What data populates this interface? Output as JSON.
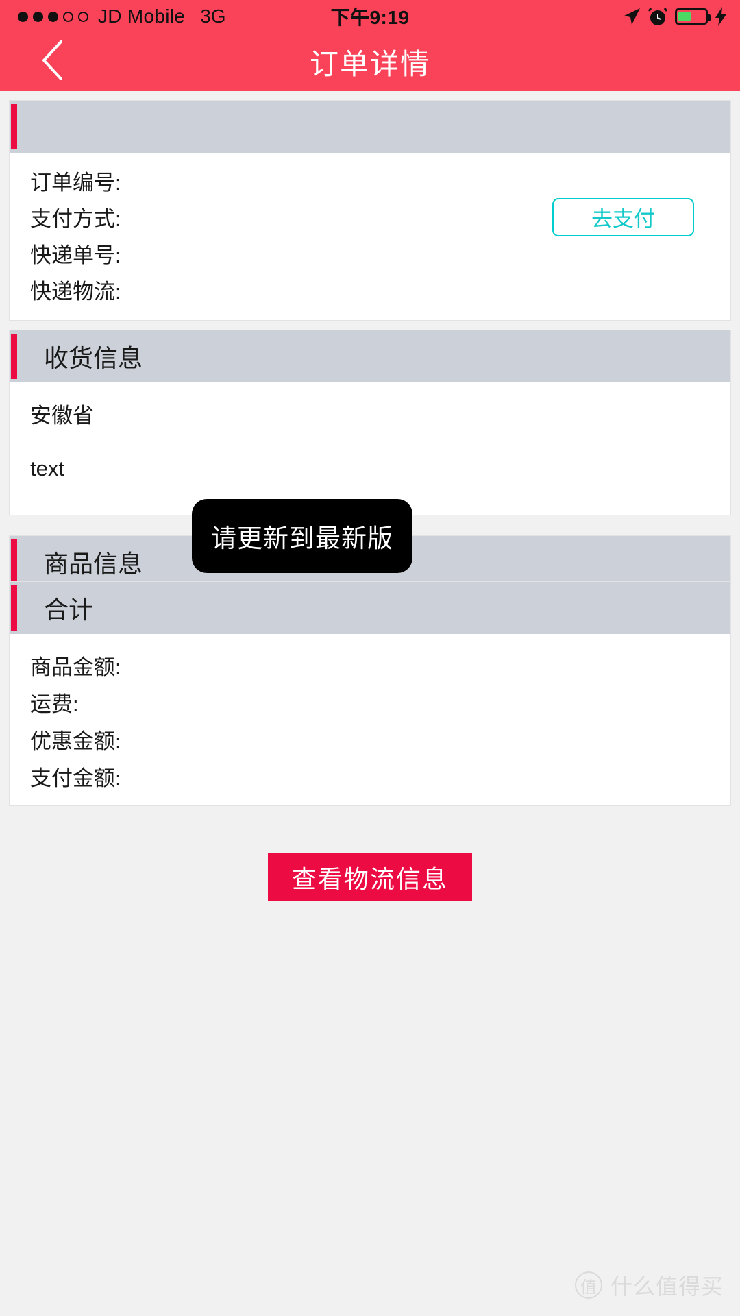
{
  "status_bar": {
    "signal_dots_filled": 3,
    "signal_dots_total": 5,
    "carrier": "JD Mobile",
    "network": "3G",
    "time": "下午9:19",
    "icons": [
      "location-arrow-icon",
      "alarm-clock-icon",
      "battery-icon",
      "charging-bolt-icon"
    ],
    "battery_level_percent": 42
  },
  "nav": {
    "back_icon": "chevron-left-icon",
    "title": "订单详情"
  },
  "colors": {
    "brand_red": "#fa4258",
    "accent_red": "#ec0b43",
    "header_gray": "#ccd0d8",
    "teal": "#00cdcd",
    "page_bg": "#f1f1f1"
  },
  "order_card": {
    "header_title": "",
    "rows": [
      {
        "label": "订单编号:",
        "value": ""
      },
      {
        "label": "支付方式:",
        "value": ""
      },
      {
        "label": "快递单号:",
        "value": ""
      },
      {
        "label": "快递物流:",
        "value": ""
      }
    ],
    "pay_button": "去支付"
  },
  "shipping_card": {
    "header_title": "收货信息",
    "line1": "安徽省",
    "line2": "text"
  },
  "product_card": {
    "header_title": "商品信息"
  },
  "totals_card": {
    "header_title": "合计",
    "rows": [
      {
        "label": "商品金额:",
        "value": ""
      },
      {
        "label": "运费:",
        "value": ""
      },
      {
        "label": "优惠金额:",
        "value": ""
      },
      {
        "label": "支付金额:",
        "value": ""
      }
    ]
  },
  "cta": {
    "label": "查看物流信息"
  },
  "toast": {
    "message": "请更新到最新版"
  },
  "watermark": {
    "logo_char": "值",
    "text": "什么值得买"
  }
}
